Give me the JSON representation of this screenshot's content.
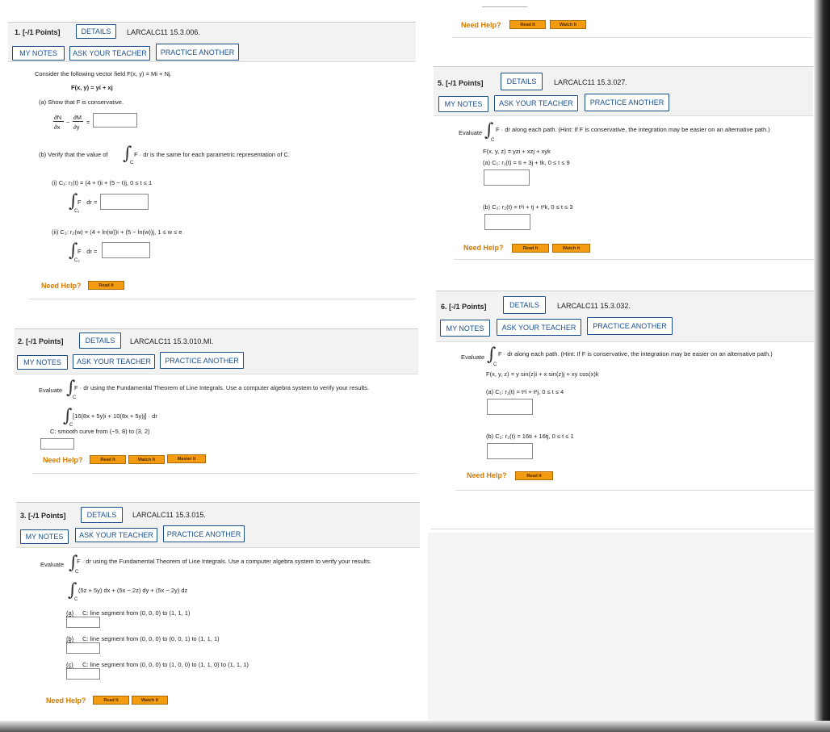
{
  "q1": {
    "points": "1. [-/1 Points]",
    "details": "DETAILS",
    "code": "LARCALC11 15.3.006.",
    "my_notes": "MY NOTES",
    "ask": "ASK YOUR TEACHER",
    "practice": "PRACTICE ANOTHER",
    "intro": "Consider the following vector field F(x, y) = Mi + Nj.",
    "field": "F(x, y) = yi + xj",
    "part_a": "(a)  Show that F is conservative.",
    "dN": "∂N",
    "dx": "∂x",
    "eq_minus": "=",
    "dM": "∂M",
    "dy": "∂y",
    "eq": "=",
    "part_b_pre": "(b)  Verify that the value of",
    "part_b_post": "F · dr is the same for each parametric representation of C.",
    "i": "(i)   C₁: r₁(t) = (4 + t)i + (5 − t)j, 0 ≤ t ≤ 1",
    "i_int": "F · dr =",
    "c1": "C₁",
    "ii": "(ii)  C₂: r₂(w) = (4 + ln(w))i + (5 − ln(w))j, 1 ≤ w ≤ e",
    "ii_int": "F · dr =",
    "c2": "C₂",
    "need": "Need Help?",
    "read": "Read It"
  },
  "q2": {
    "points": "2. [-/1 Points]",
    "details": "DETAILS",
    "code": "LARCALC11 15.3.010.MI.",
    "my_notes": "MY NOTES",
    "ask": "ASK YOUR TEACHER",
    "practice": "PRACTICE ANOTHER",
    "evaluate": "Evaluate",
    "text": "F · dr using the Fundamental Theorem of Line Integrals. Use a computer algebra system to verify your results.",
    "c": "C",
    "integrand": "[16(8x + 5y)i + 10(8x + 5y)j] · dr",
    "curve": "C: smooth curve from (−5, 8) to (3, 2)",
    "need": "Need Help?",
    "read": "Read It",
    "watch": "Watch It",
    "master": "Master It"
  },
  "q3": {
    "points": "3. [-/1 Points]",
    "details": "DETAILS",
    "code": "LARCALC11 15.3.015.",
    "my_notes": "MY NOTES",
    "ask": "ASK YOUR TEACHER",
    "practice": "PRACTICE ANOTHER",
    "evaluate": "Evaluate",
    "text": "F · dr using the Fundamental Theorem of Line Integrals. Use a computer algebra system to verify your results.",
    "c": "C",
    "integrand": "(5z + 5y) dx + (5x − 2z) dy + (5x − 2y) dz",
    "a_label": "(a)",
    "a": "C: line segment from (0, 0, 0) to (1, 1, 1)",
    "b_label": "(b)",
    "b": "C: line segment from (0, 0, 0) to (0, 0, 1) to (1, 1, 1)",
    "c_label": "(c)",
    "c_text": "C: line segment from (0, 0, 0) to (1, 0, 0) to (1, 1, 0) to (1, 1, 1)",
    "need": "Need Help?",
    "read": "Read It",
    "watch": "Watch It"
  },
  "top_right": {
    "need": "Need Help?",
    "read": "Read It",
    "watch": "Watch It"
  },
  "q5": {
    "points": "5. [-/1 Points]",
    "details": "DETAILS",
    "code": "LARCALC11 15.3.027.",
    "my_notes": "MY NOTES",
    "ask": "ASK YOUR TEACHER",
    "practice": "PRACTICE ANOTHER",
    "evaluate": "Evaluate",
    "text": "F · dr along each path. (Hint: If F is conservative, the integration may be easier on an alternative path.)",
    "c": "C",
    "field": "F(x, y, z) = yzi + xzj + xyk",
    "a": "(a)   C₁: r₁(t) = ti + 3j + tk,  0 ≤ t ≤ 9",
    "b": "(b)   C₂: r₂(t) = t²i + tj + t²k,  0 ≤ t ≤ 3",
    "need": "Need Help?",
    "read": "Read It",
    "watch": "Watch It"
  },
  "q6": {
    "points": "6. [-/1 Points]",
    "details": "DETAILS",
    "code": "LARCALC11 15.3.032.",
    "my_notes": "MY NOTES",
    "ask": "ASK YOUR TEACHER",
    "practice": "PRACTICE ANOTHER",
    "evaluate": "Evaluate",
    "text": "F · dr along each path. (Hint: If F is conservative, the integration may be easier on an alternative path.)",
    "c": "C",
    "field": "F(x, y, z) = y sin(z)i + x sin(z)j + xy cos(x)k",
    "a": "(a)   C₁: r₁(t) = t²i + t²j,  0 ≤ t ≤ 4",
    "b": "(b)   C₂: r₂(t) = 16ti + 16tj,  0 ≤ t ≤ 1",
    "need": "Need Help?",
    "read": "Read It"
  }
}
